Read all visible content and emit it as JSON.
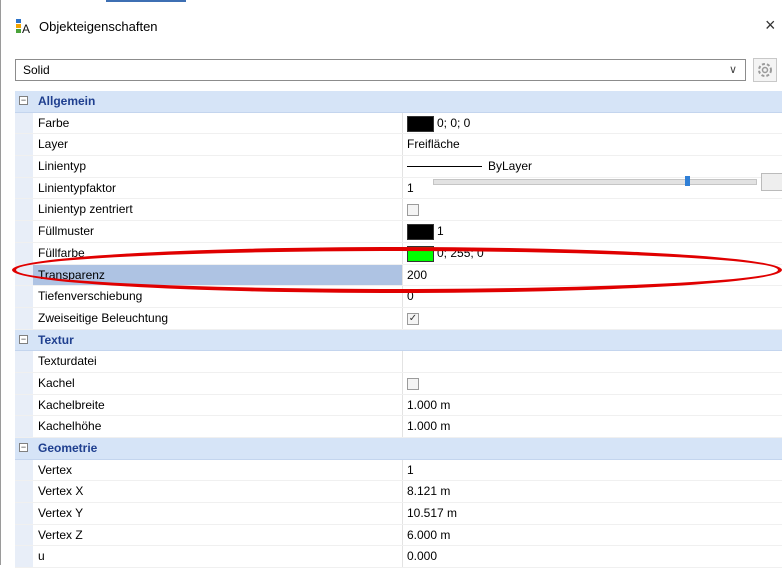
{
  "window": {
    "title": "Objekteigenschaften",
    "close_glyph": "×"
  },
  "selector": {
    "value": "Solid",
    "arrow": "∨"
  },
  "categories": [
    {
      "label": "Allgemein",
      "rows": [
        {
          "name": "Farbe",
          "value": "0; 0; 0",
          "swatch": "#000000"
        },
        {
          "name": "Layer",
          "value": "Freifläche"
        },
        {
          "name": "Linientyp",
          "value": "ByLayer"
        },
        {
          "name": "Linientypfaktor",
          "value": "1"
        },
        {
          "name": "Linientyp zentriert",
          "checked": false
        },
        {
          "name": "Füllmuster",
          "value": "1",
          "swatch": "#000000"
        },
        {
          "name": "Füllfarbe",
          "value": "0; 255; 0",
          "swatch": "#00ff00"
        },
        {
          "name": "Transparenz",
          "value": "200",
          "selected": true,
          "slider_fraction": 0.78
        },
        {
          "name": "Tiefenverschiebung",
          "value": "0"
        },
        {
          "name": "Zweiseitige Beleuchtung",
          "checked": true
        }
      ]
    },
    {
      "label": "Textur",
      "rows": [
        {
          "name": "Texturdatei",
          "value": ""
        },
        {
          "name": "Kachel",
          "checked": false
        },
        {
          "name": "Kachelbreite",
          "value": "1.000 m"
        },
        {
          "name": "Kachelhöhe",
          "value": "1.000 m"
        }
      ]
    },
    {
      "label": "Geometrie",
      "rows": [
        {
          "name": "Vertex",
          "value": "1"
        },
        {
          "name": "Vertex X",
          "value": "8.121 m"
        },
        {
          "name": "Vertex Y",
          "value": "10.517 m"
        },
        {
          "name": "Vertex Z",
          "value": "6.000 m"
        },
        {
          "name": "u",
          "value": "0.000"
        }
      ]
    }
  ],
  "colors": {
    "highlight_ellipse": "#e00000",
    "category_bg": "#d6e4f7",
    "selection_bg": "#aec3e3"
  }
}
